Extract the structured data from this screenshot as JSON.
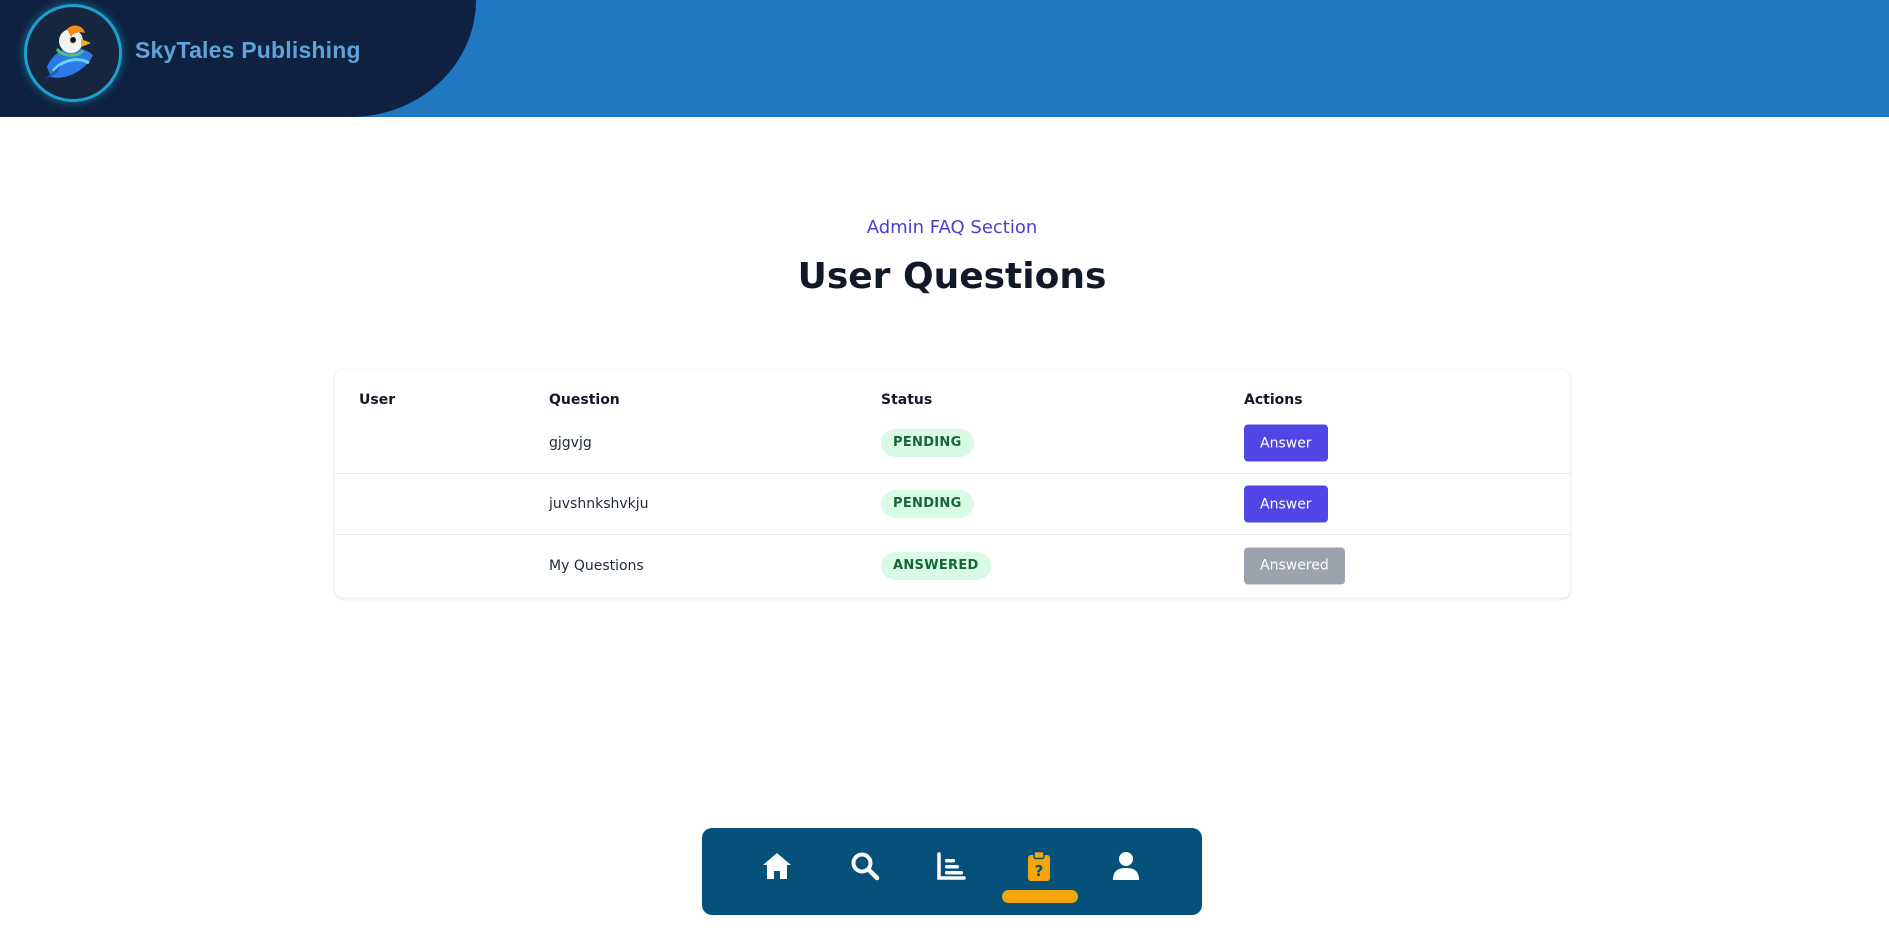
{
  "brand": {
    "name": "SkyTales Publishing",
    "logo_icon": "parrot-logo"
  },
  "section": {
    "eyebrow": "Admin FAQ Section",
    "title": "User Questions"
  },
  "table": {
    "headers": {
      "user": "User",
      "question": "Question",
      "status": "Status",
      "actions": "Actions"
    },
    "rows": [
      {
        "user": "",
        "question": "gjgvjg",
        "status": "PENDING",
        "action": "Answer"
      },
      {
        "user": "",
        "question": "juvshnkshvkju",
        "status": "PENDING",
        "action": "Answer"
      },
      {
        "user": "",
        "question": "My Questions",
        "status": "ANSWERED",
        "action": "Answered"
      }
    ]
  },
  "nav": {
    "items": [
      {
        "icon": "home-icon"
      },
      {
        "icon": "search-icon"
      },
      {
        "icon": "chart-icon"
      },
      {
        "icon": "faq-clipboard-icon",
        "active": true
      },
      {
        "icon": "user-icon"
      }
    ]
  },
  "colors": {
    "header": "#1f78c1",
    "brand_panel": "#0f2140",
    "accent": "#4f46e5",
    "badge_bg": "#d9fbe6",
    "nav_bg": "#055179",
    "nav_active": "#f5a50d"
  }
}
